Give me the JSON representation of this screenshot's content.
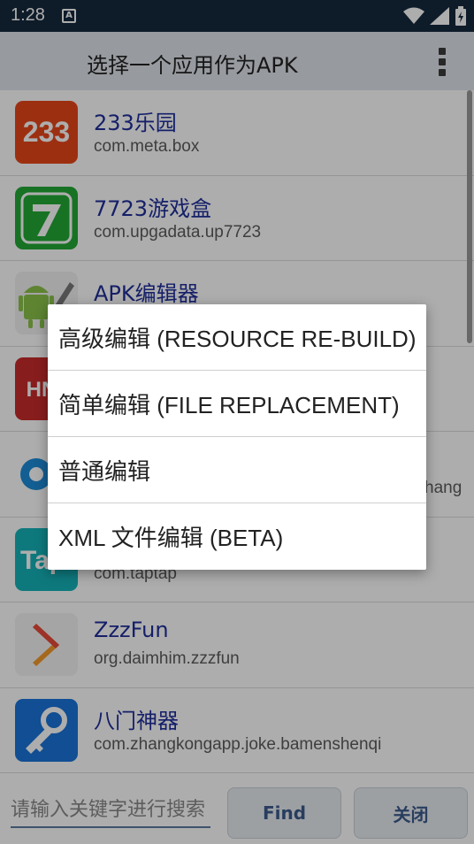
{
  "status_bar": {
    "time": "1:28",
    "notification_letter": "A"
  },
  "app_bar": {
    "title": "选择一个应用作为APK"
  },
  "apps": [
    {
      "name": "233乐园",
      "package": "com.meta.box",
      "icon_text": "233",
      "icon_color": "#e8461a"
    },
    {
      "name": "7723游戏盒",
      "package": "com.upgadata.up7723",
      "icon_text": "7",
      "icon_color": "#22a836"
    },
    {
      "name": "APK编辑器",
      "package": "",
      "icon_text": "",
      "icon_color": "#f2f2f2"
    },
    {
      "name": "",
      "package": "",
      "icon_text": "HN",
      "icon_color": "#c92b2b"
    },
    {
      "name": "",
      "package": "hang",
      "icon_text": "",
      "icon_color": "#1d8bd8"
    },
    {
      "name": "",
      "package": "com.taptap",
      "icon_text": "Tap",
      "icon_color": "#16b3b8"
    },
    {
      "name": "ZzzFun",
      "package": "org.daimhim.zzzfun",
      "icon_text": "",
      "icon_color": "#f4f4f4"
    },
    {
      "name": "八门神器",
      "package": "com.zhangkongapp.joke.bamenshenqi",
      "icon_text": "",
      "icon_color": "#1a73d9"
    }
  ],
  "dialog": {
    "items": [
      {
        "label": "高级编辑 (RESOURCE RE-BUILD)"
      },
      {
        "label": "简单编辑 (FILE REPLACEMENT)"
      },
      {
        "label": "普通编辑"
      },
      {
        "label": "XML 文件编辑 (BETA)"
      }
    ]
  },
  "bottom_bar": {
    "search_placeholder": "请输入关键字进行搜索",
    "find_label": "Find",
    "close_label": "关闭"
  }
}
